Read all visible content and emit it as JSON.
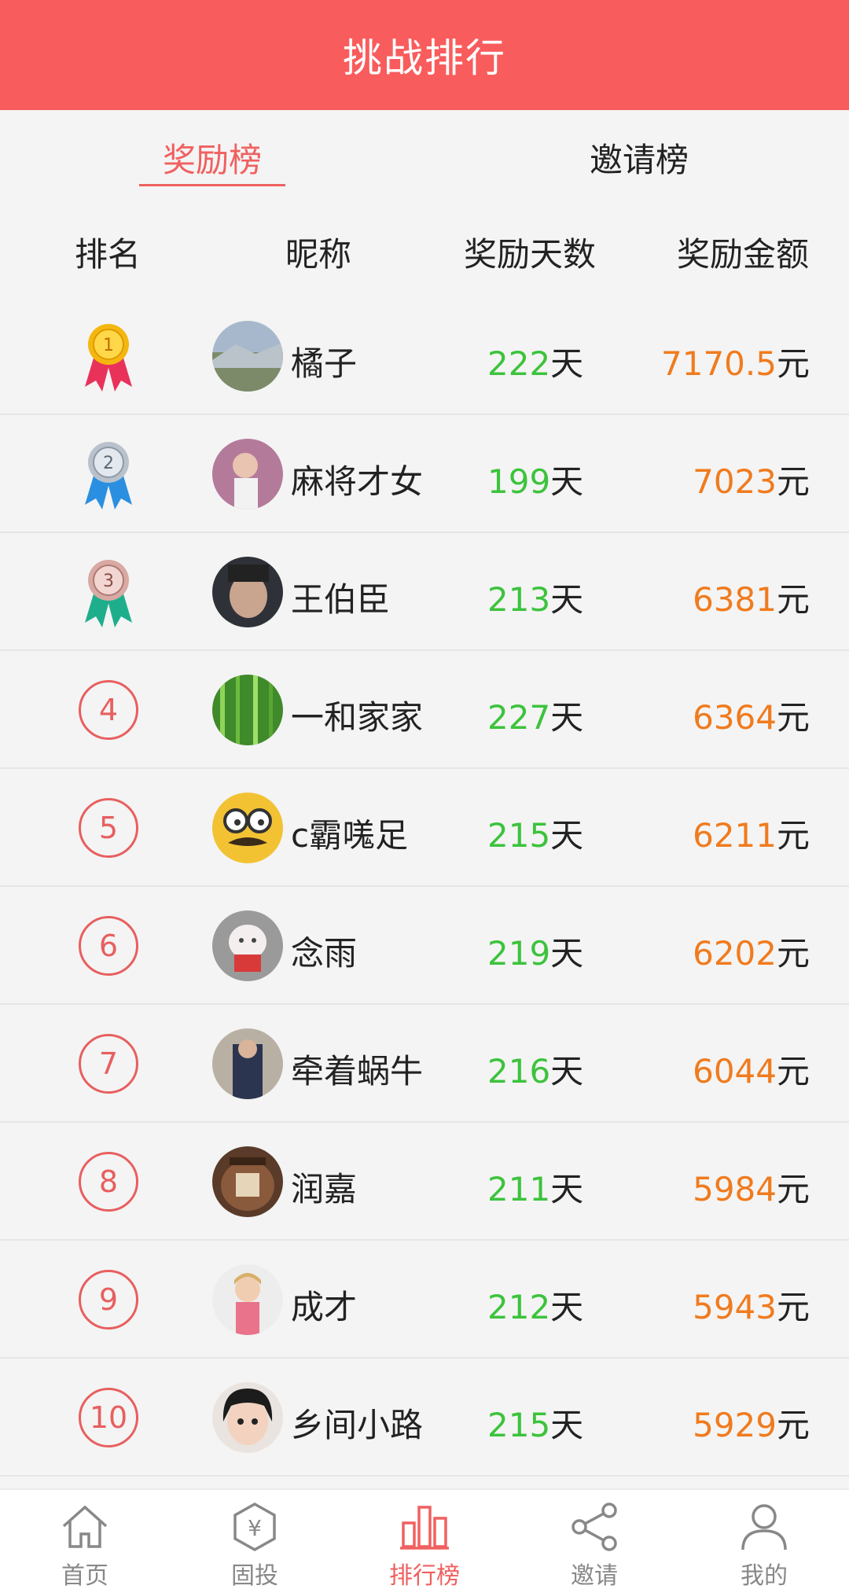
{
  "header": {
    "title": "挑战排行"
  },
  "tabs": [
    {
      "label": "奖励榜",
      "active": true
    },
    {
      "label": "邀请榜",
      "active": false
    }
  ],
  "columns": {
    "rank": "排名",
    "nickname": "昵称",
    "days": "奖励天数",
    "amount": "奖励金额"
  },
  "rows": [
    {
      "rank": "1",
      "rank_style": "gold-medal",
      "nickname": "橘子",
      "days": "222",
      "amount": "7170.5"
    },
    {
      "rank": "2",
      "rank_style": "silver-medal",
      "nickname": "麻将才女",
      "days": "199",
      "amount": "7023"
    },
    {
      "rank": "3",
      "rank_style": "bronze-medal",
      "nickname": "王伯臣",
      "days": "213",
      "amount": "6381"
    },
    {
      "rank": "4",
      "rank_style": "circle",
      "nickname": "一和家家",
      "days": "227",
      "amount": "6364"
    },
    {
      "rank": "5",
      "rank_style": "circle",
      "nickname": "c霸嗴足",
      "days": "215",
      "amount": "6211"
    },
    {
      "rank": "6",
      "rank_style": "circle",
      "nickname": "念雨",
      "days": "219",
      "amount": "6202"
    },
    {
      "rank": "7",
      "rank_style": "circle",
      "nickname": "牵着蜗牛",
      "days": "216",
      "amount": "6044"
    },
    {
      "rank": "8",
      "rank_style": "circle",
      "nickname": "润嘉",
      "days": "211",
      "amount": "5984"
    },
    {
      "rank": "9",
      "rank_style": "circle",
      "nickname": "成才",
      "days": "212",
      "amount": "5943"
    },
    {
      "rank": "10",
      "rank_style": "circle",
      "nickname": "乡间小路",
      "days": "215",
      "amount": "5929"
    }
  ],
  "units": {
    "days": "天",
    "amount": "元"
  },
  "nav": [
    {
      "label": "首页",
      "icon": "home-icon",
      "active": false
    },
    {
      "label": "固投",
      "icon": "yen-hexagon-icon",
      "active": false
    },
    {
      "label": "排行榜",
      "icon": "bar-chart-icon",
      "active": true
    },
    {
      "label": "邀请",
      "icon": "share-icon",
      "active": false
    },
    {
      "label": "我的",
      "icon": "user-icon",
      "active": false
    }
  ],
  "colors": {
    "header_bg": "#f95c5c",
    "accent": "#f06060",
    "days_green": "#3cc33c",
    "amount_orange": "#f07b1e"
  }
}
